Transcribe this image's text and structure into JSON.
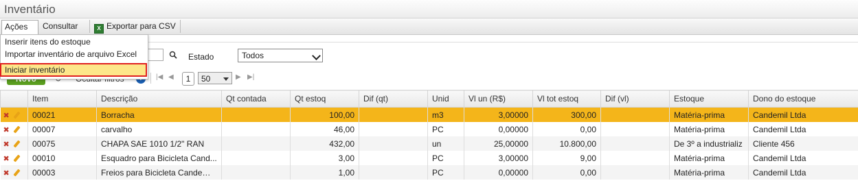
{
  "title": "Inventário",
  "toolbar": {
    "acoes": "Ações",
    "consultar": "Consultar",
    "exportar": "Exportar para CSV"
  },
  "menu": {
    "items": [
      "Inserir itens do estoque",
      "Importar inventário de arquivo Excel",
      "Iniciar inventário"
    ]
  },
  "filters": {
    "estado_label": "Estado",
    "estado_value": "Todos"
  },
  "list_toolbar": {
    "novo": "Novo",
    "ocultar": "Ocultar filtros",
    "page": "1",
    "page_size": "50"
  },
  "table": {
    "headers": [
      "Item",
      "Descrição",
      "Qt contada",
      "Qt estoq",
      "Dif (qt)",
      "Unid",
      "Vl un (R$)",
      "Vl tot estoq",
      "Dif (vl)",
      "Estoque",
      "Dono do estoque"
    ],
    "rows": [
      [
        "00021",
        "Borracha",
        "",
        "100,00",
        "",
        "m3",
        "3,00000",
        "300,00",
        "",
        "Matéria-prima",
        "Candemil Ltda"
      ],
      [
        "00007",
        "carvalho",
        "",
        "46,00",
        "",
        "PC",
        "0,00000",
        "0,00",
        "",
        "Matéria-prima",
        "Candemil Ltda"
      ],
      [
        "00075",
        "CHAPA SAE 1010 1/2\" RAN",
        "",
        "432,00",
        "",
        "un",
        "25,00000",
        "10.800,00",
        "",
        "De 3º a industrializ",
        "Cliente 456"
      ],
      [
        "00010",
        "Esquadro para Bicicleta Cand...",
        "",
        "3,00",
        "",
        "PC",
        "3,00000",
        "9,00",
        "",
        "Matéria-prima",
        "Candemil Ltda"
      ],
      [
        "00003",
        "Freios para Bicicleta Candemi...",
        "",
        "1,00",
        "",
        "PC",
        "0,00000",
        "0,00",
        "",
        "Matéria-prima",
        "Candemil Ltda"
      ]
    ]
  },
  "colors": {
    "selected_row": "#f4b51a",
    "novo_button": "#5a9e1f",
    "highlight_outline": "#e02020"
  }
}
